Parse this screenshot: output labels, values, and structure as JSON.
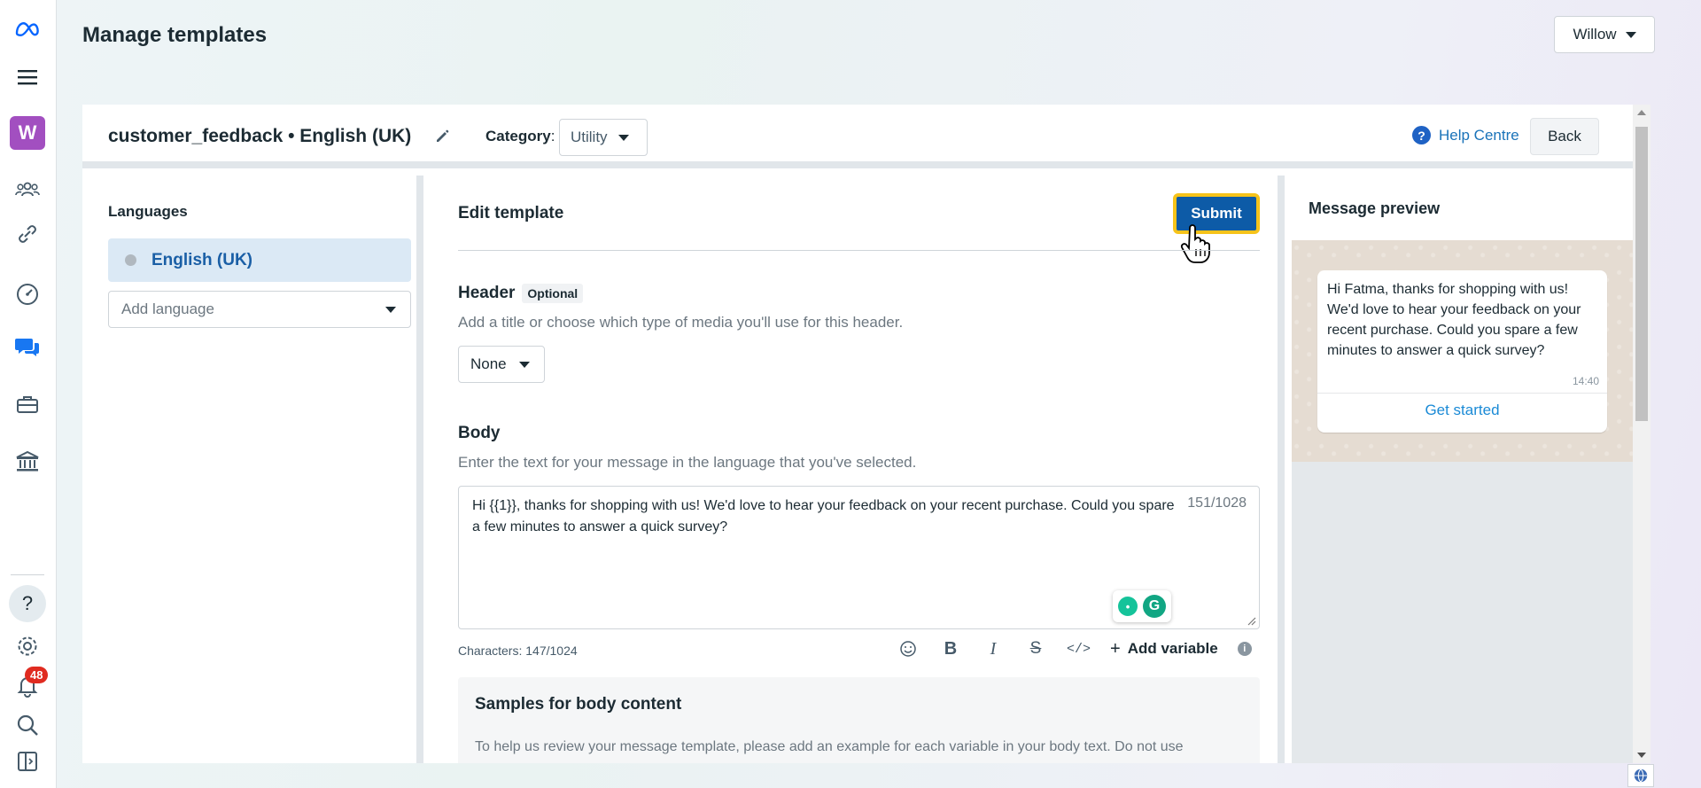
{
  "app": {
    "page_title": "Manage templates",
    "account": "Willow"
  },
  "rail": {
    "workspace_initial": "W",
    "notifications_count": "48",
    "help_symbol": "?",
    "icons": [
      "meta-logo-icon",
      "menu-icon",
      "audience-icon",
      "link-icon",
      "dashboard-icon",
      "chat-icon",
      "briefcase-icon",
      "institution-icon",
      "help-icon",
      "settings-icon",
      "bell-icon",
      "search-icon",
      "panel-toggle-icon"
    ]
  },
  "template": {
    "name": "customer_feedback • English (UK)",
    "category_label": "Category",
    "category_colon": ":",
    "category_value": "Utility",
    "help_link": "Help Centre",
    "back": "Back"
  },
  "languages": {
    "title": "Languages",
    "items": [
      {
        "label": "English (UK)"
      }
    ],
    "add_placeholder": "Add language"
  },
  "editor": {
    "title": "Edit template",
    "submit": "Submit",
    "header": {
      "title": "Header",
      "optional": "Optional",
      "description": "Add a title or choose which type of media you'll use for this header.",
      "media_type": "None"
    },
    "body": {
      "title": "Body",
      "description": "Enter the text for your message in the language that you've selected.",
      "text": "Hi {{1}}, thanks for shopping with us! We'd love to hear your feedback on your recent purchase. Could you spare a few minutes to answer a quick survey?",
      "counter": "151/1028",
      "characters": "Characters: 147/1024",
      "add_variable": "Add variable"
    },
    "samples": {
      "title": "Samples for body content",
      "description": "To help us review your message template, please add an example for each variable in your body text. Do not use"
    }
  },
  "preview": {
    "title": "Message preview",
    "message": "Hi Fatma, thanks for shopping with us! We'd love to hear your feedback on your recent purchase. Could you spare a few minutes to answer a quick survey?",
    "time": "14:40",
    "action": "Get started"
  },
  "colors": {
    "primary": "#0d5ba7",
    "focus_ring": "#f6c31a",
    "link": "#1a73b9",
    "badge": "#e02b20",
    "workspace": "#a24fc0"
  }
}
